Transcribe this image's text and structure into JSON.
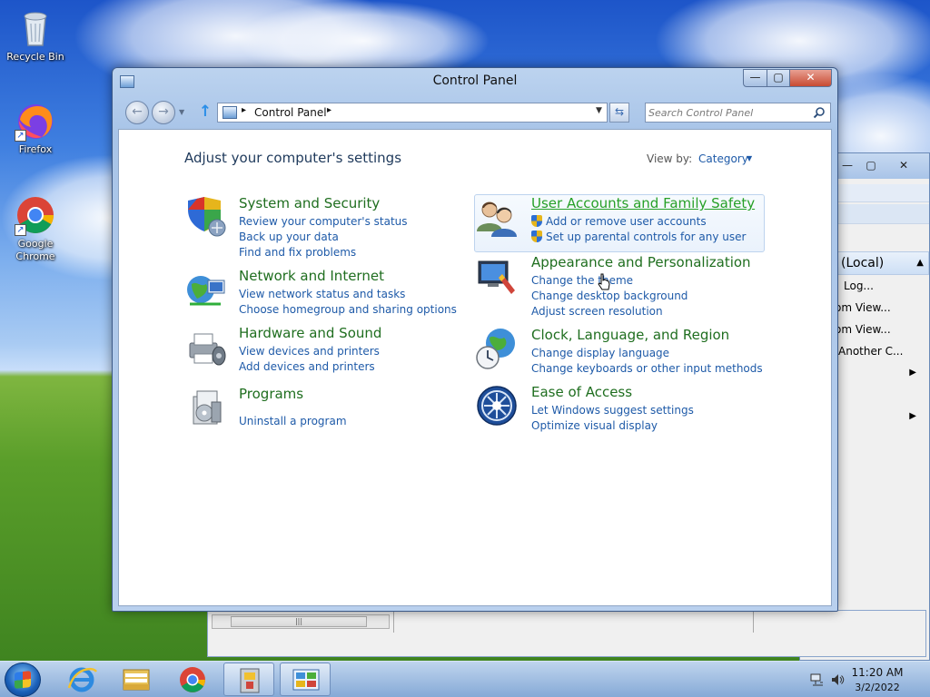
{
  "desktop": {
    "icons": [
      {
        "label": "Recycle Bin"
      },
      {
        "label": "Firefox"
      },
      {
        "label": "Google Chrome"
      }
    ]
  },
  "background_window": {
    "min_label": "—",
    "max_label": "▢",
    "close_label": "✕",
    "list_header": "(Local)",
    "items": [
      "Log...",
      "om View...",
      "om View...",
      "Another C..."
    ],
    "scroll_label": "|||"
  },
  "window": {
    "title": "Control Panel",
    "min_label": "—",
    "max_label": "▢",
    "close_label": "✕"
  },
  "address_bar": {
    "path_label": "Control Panel",
    "separator": "▸"
  },
  "search": {
    "placeholder": "Search Control Panel"
  },
  "content": {
    "heading": "Adjust your computer's settings",
    "view_by_label": "View by:",
    "view_by_value": "Category"
  },
  "categories": [
    {
      "title": "System and Security",
      "links": [
        "Review your computer's status",
        "Back up your data",
        "Find and fix problems"
      ]
    },
    {
      "title": "Network and Internet",
      "links": [
        "View network status and tasks",
        "Choose homegroup and sharing options"
      ]
    },
    {
      "title": "Hardware and Sound",
      "links": [
        "View devices and printers",
        "Add devices and printers"
      ]
    },
    {
      "title": "Programs",
      "links": [
        "Uninstall a program"
      ]
    },
    {
      "title": "User Accounts and Family Safety",
      "links": [
        "Add or remove user accounts",
        "Set up parental controls for any user"
      ]
    },
    {
      "title": "Appearance and Personalization",
      "links": [
        "Change the theme",
        "Change desktop background",
        "Adjust screen resolution"
      ]
    },
    {
      "title": "Clock, Language, and Region",
      "links": [
        "Change display language",
        "Change keyboards or other input methods"
      ]
    },
    {
      "title": "Ease of Access",
      "links": [
        "Let Windows suggest settings",
        "Optimize visual display"
      ]
    }
  ],
  "taskbar": {
    "time": "11:20 AM",
    "date": "3/2/2022"
  },
  "colors": {
    "category_title": "#1f6e1f",
    "link": "#1e5aa8",
    "hover_title": "#27a027"
  }
}
